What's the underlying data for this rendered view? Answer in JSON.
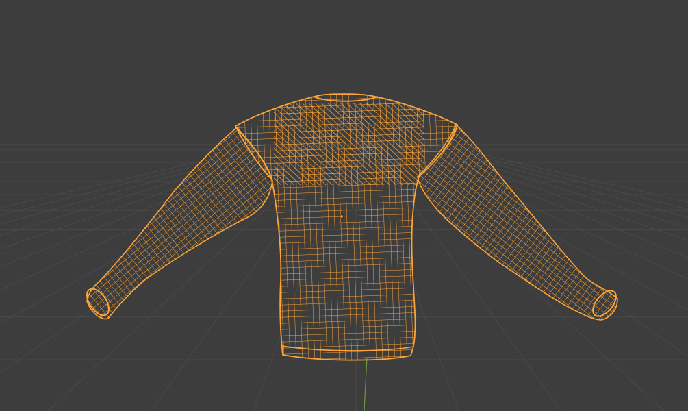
{
  "viewport": {
    "mode": "3d-viewport",
    "shading": "wireframe",
    "background_color": "#3d3d3d",
    "grid_color": "#555555",
    "y_axis_color": "#6a9a3a"
  },
  "object": {
    "type": "mesh",
    "icon": "sweater-mesh-icon",
    "selected": true,
    "wire_color": "#ffa436",
    "origin_color": "#ff8c00"
  }
}
